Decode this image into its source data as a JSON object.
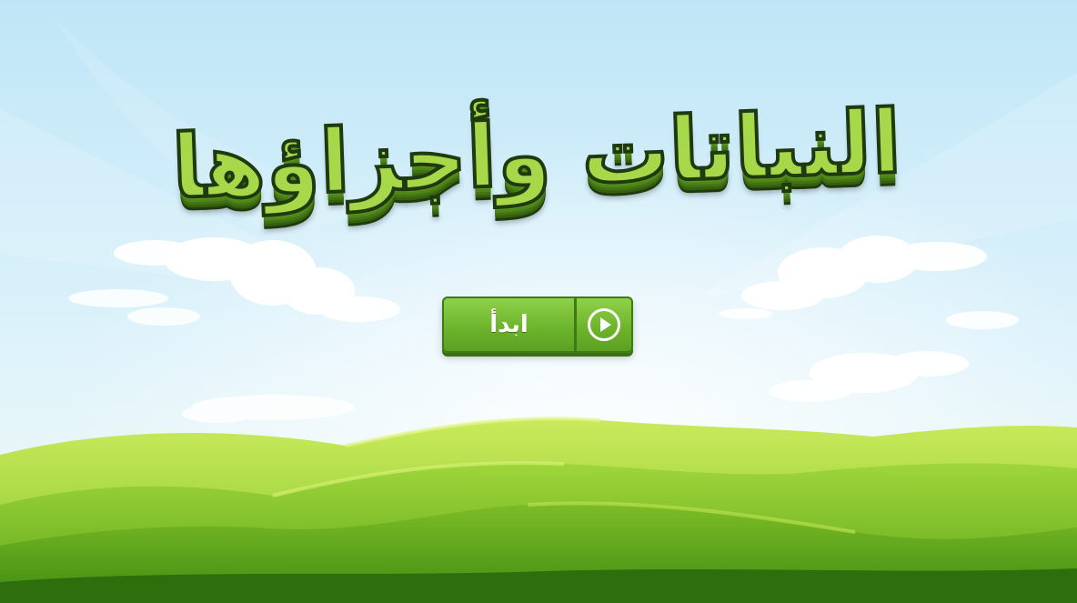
{
  "game": {
    "title": "النباتات وأجزاؤها",
    "start_label": "ابدأ",
    "start_icon": "play-circle-icon"
  },
  "colors": {
    "sky_top": "#bfe6f7",
    "sky_bottom": "#eaf8ff",
    "hill_light": "#b6e04c",
    "hill_mid": "#7cc226",
    "hill_dark": "#3f8a12",
    "button_green": "#6db52c",
    "title_green": "#a6d84a"
  }
}
